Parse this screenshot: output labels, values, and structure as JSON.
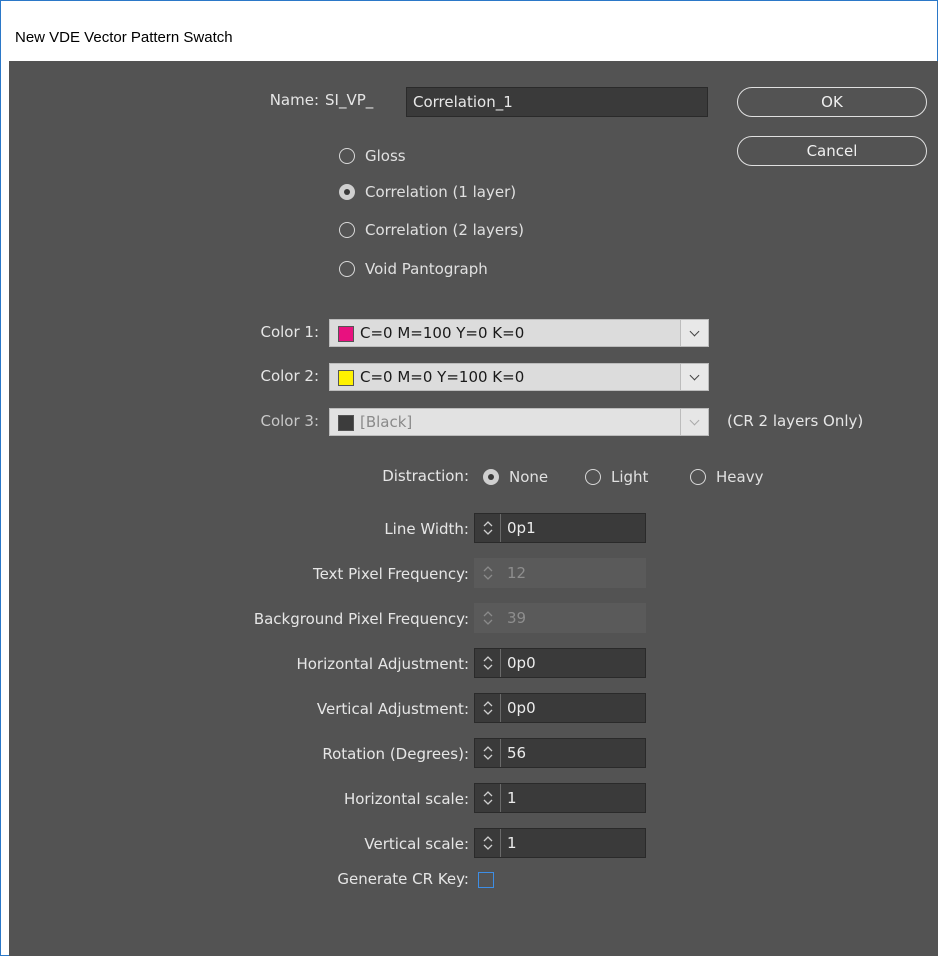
{
  "window": {
    "title": "New VDE Vector Pattern Swatch"
  },
  "name": {
    "label": "Name:",
    "prefix": "SI_VP_",
    "value": "Correlation_1"
  },
  "buttons": {
    "ok": "OK",
    "cancel": "Cancel"
  },
  "pattern_options": [
    {
      "label": "Gloss",
      "selected": false
    },
    {
      "label": "Correlation (1 layer)",
      "selected": true
    },
    {
      "label": "Correlation (2 layers)",
      "selected": false
    },
    {
      "label": "Void Pantograph",
      "selected": false
    }
  ],
  "colors": [
    {
      "label": "Color 1:",
      "value": "C=0 M=100 Y=0 K=0",
      "swatch": "#e8117f",
      "enabled": true
    },
    {
      "label": "Color 2:",
      "value": "C=0 M=0 Y=100 K=0",
      "swatch": "#fff200",
      "enabled": true
    },
    {
      "label": "Color 3:",
      "value": "[Black]",
      "swatch": "#3c3c3c",
      "enabled": false,
      "note": "(CR 2 layers Only)"
    }
  ],
  "distraction": {
    "label": "Distraction:",
    "options": [
      {
        "label": "None",
        "selected": true
      },
      {
        "label": "Light",
        "selected": false
      },
      {
        "label": "Heavy",
        "selected": false
      }
    ]
  },
  "fields": [
    {
      "label": "Line Width:",
      "value": "0p1",
      "enabled": true
    },
    {
      "label": "Text Pixel Frequency:",
      "value": "12",
      "enabled": false
    },
    {
      "label": "Background Pixel Frequency:",
      "value": "39",
      "enabled": false
    },
    {
      "label": "Horizontal Adjustment:",
      "value": "0p0",
      "enabled": true
    },
    {
      "label": "Vertical Adjustment:",
      "value": "0p0",
      "enabled": true
    },
    {
      "label": "Rotation (Degrees):",
      "value": "56",
      "enabled": true
    },
    {
      "label": "Horizontal scale:",
      "value": "1",
      "enabled": true
    },
    {
      "label": "Vertical scale:",
      "value": "1",
      "enabled": true
    }
  ],
  "cr_key": {
    "label": "Generate CR Key:",
    "checked": false
  }
}
